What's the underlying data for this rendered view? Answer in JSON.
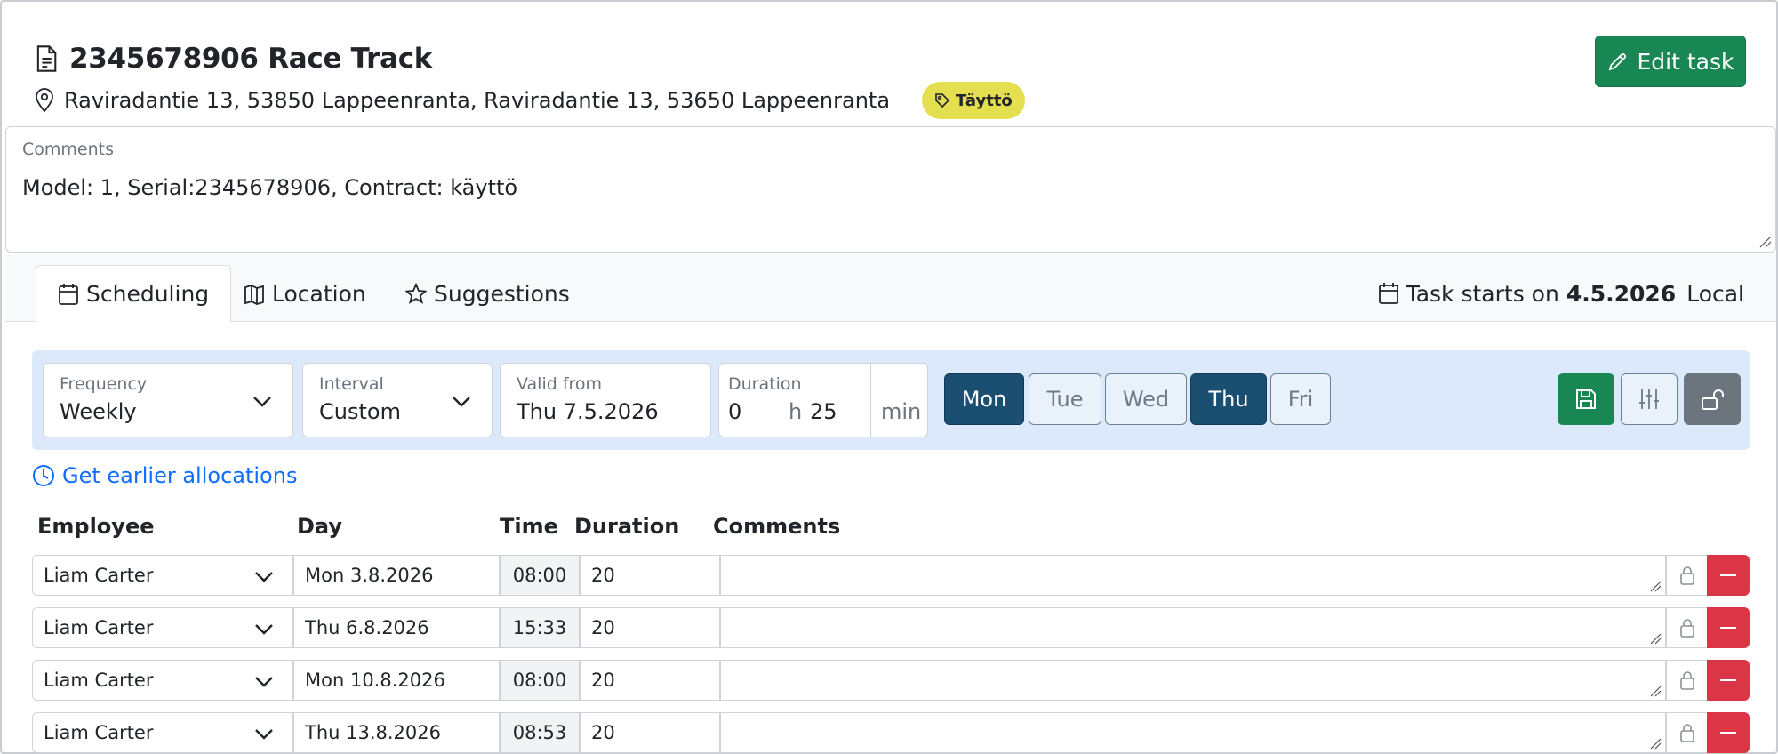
{
  "header": {
    "title": "2345678906 Race Track",
    "address": "Raviradantie 13, 53850 Lappeenranta, Raviradantie 13, 53650 Lappeenranta",
    "badge": "Täyttö",
    "edit_label": "Edit task"
  },
  "comments": {
    "label": "Comments",
    "text": "Model: 1, Serial:2345678906, Contract: käyttö"
  },
  "tabs": [
    {
      "label": "Scheduling",
      "icon": "calendar-icon",
      "active": true
    },
    {
      "label": "Location",
      "icon": "map-icon",
      "active": false
    },
    {
      "label": "Suggestions",
      "icon": "star-icon",
      "active": false
    }
  ],
  "task_starts": {
    "prefix": "Task starts on",
    "date": "4.5.2026",
    "zone": "Local"
  },
  "schedule": {
    "frequency_label": "Frequency",
    "frequency_value": "Weekly",
    "interval_label": "Interval",
    "interval_value": "Custom",
    "valid_from_label": "Valid from",
    "valid_from_value": "Thu 7.5.2026",
    "duration_label": "Duration",
    "duration_hours": "0",
    "hours_unit": "h",
    "duration_minutes": "25",
    "minutes_unit": "min",
    "days": [
      {
        "label": "Mon",
        "on": true
      },
      {
        "label": "Tue",
        "on": false
      },
      {
        "label": "Wed",
        "on": false
      },
      {
        "label": "Thu",
        "on": true
      },
      {
        "label": "Fri",
        "on": false
      }
    ]
  },
  "earlier_link": "Get earlier allocations",
  "table": {
    "headers": {
      "employee": "Employee",
      "day": "Day",
      "time": "Time",
      "duration": "Duration",
      "comments": "Comments"
    },
    "rows": [
      {
        "employee": "Liam Carter",
        "day": "Mon 3.8.2026",
        "time": "08:00",
        "duration": "20",
        "comment": ""
      },
      {
        "employee": "Liam Carter",
        "day": "Thu 6.8.2026",
        "time": "15:33",
        "duration": "20",
        "comment": ""
      },
      {
        "employee": "Liam Carter",
        "day": "Mon 10.8.2026",
        "time": "08:00",
        "duration": "20",
        "comment": ""
      },
      {
        "employee": "Liam Carter",
        "day": "Thu 13.8.2026",
        "time": "08:53",
        "duration": "20",
        "comment": ""
      }
    ]
  },
  "colors": {
    "success": "#198754",
    "badge": "#e3df4e",
    "day_on": "#1b4f72",
    "danger": "#dc3545",
    "link": "#0d6efd",
    "panel": "#dbe9fa"
  }
}
